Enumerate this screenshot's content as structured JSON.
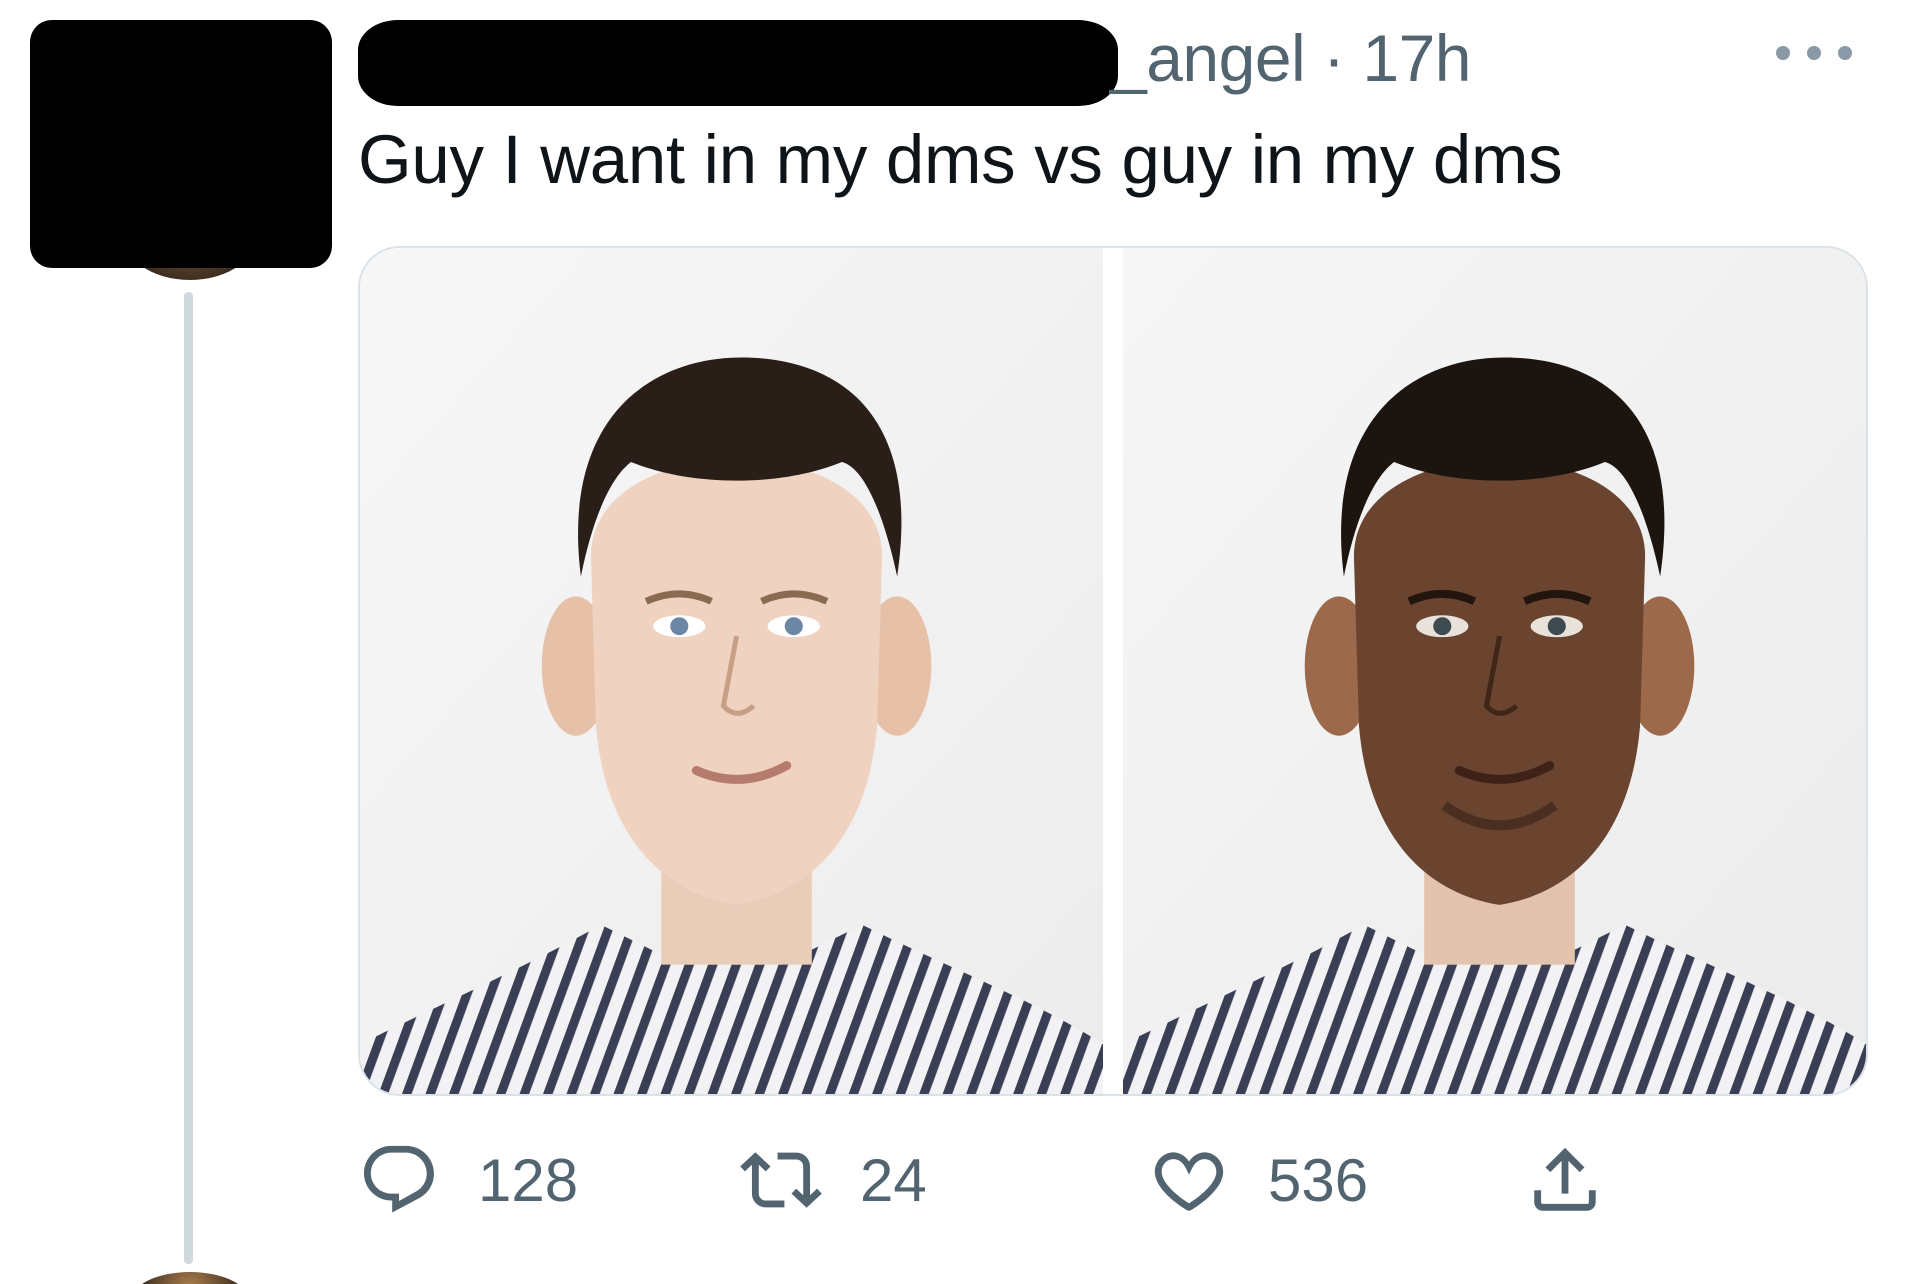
{
  "tweet": {
    "handle_suffix": "_angel",
    "separator": "·",
    "time": "17h",
    "text": "Guy I want in my dms vs guy in my dms"
  },
  "media": {
    "left_image": "photo of man with light skin in striped shirt",
    "right_image": "edited photo of same pose with darker skin tone"
  },
  "actions": {
    "replies": "128",
    "retweets": "24",
    "likes": "536"
  },
  "icons": {
    "reply": "reply-icon",
    "retweet": "retweet-icon",
    "like": "heart-icon",
    "share": "share-icon",
    "more": "more-icon"
  },
  "colors": {
    "text": "#0f1419",
    "secondary": "#536471",
    "thread_line": "#cfd9de",
    "redaction": "#000000"
  }
}
